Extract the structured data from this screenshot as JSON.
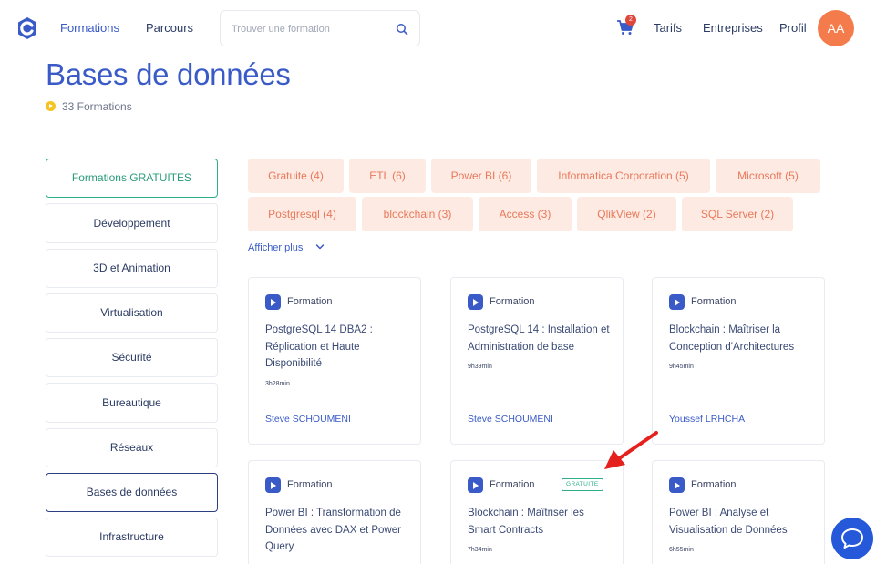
{
  "header": {
    "nav_formations": "Formations",
    "nav_parcours": "Parcours",
    "search_placeholder": "Trouver une formation",
    "cart_count": "2",
    "nav_tarifs": "Tarifs",
    "nav_entreprises": "Entreprises",
    "nav_profil": "Profil",
    "avatar_initials": "AA"
  },
  "page": {
    "title": "Bases de données",
    "count": "33 Formations"
  },
  "sidebar": {
    "items": [
      {
        "label": "Formations GRATUITES",
        "state": "free"
      },
      {
        "label": "Développement"
      },
      {
        "label": "3D et Animation"
      },
      {
        "label": "Virtualisation"
      },
      {
        "label": "Sécurité"
      },
      {
        "label": "Bureautique"
      },
      {
        "label": "Réseaux"
      },
      {
        "label": "Bases de données",
        "state": "active"
      },
      {
        "label": "Infrastructure"
      }
    ]
  },
  "tags": [
    "Gratuite (4)",
    "ETL (6)",
    "Power BI (6)",
    "Informatica Corporation (5)",
    "Microsoft (5)",
    "Postgresql (4)",
    "blockchain (3)",
    "Access (3)",
    "QlikView (2)",
    "SQL Server (2)"
  ],
  "show_more": "Afficher plus",
  "cards": [
    {
      "type": "Formation",
      "title": "PostgreSQL 14 DBA2 : Réplication et Haute Disponibilité",
      "duration": "3h28min",
      "author": "Steve SCHOUMENI"
    },
    {
      "type": "Formation",
      "title": "PostgreSQL 14 : Installation et Administration de base",
      "duration": "9h39min",
      "author": "Steve SCHOUMENI"
    },
    {
      "type": "Formation",
      "title": "Blockchain : Maîtriser la Conception d'Architectures",
      "duration": "9h45min",
      "author": "Youssef LRHCHA"
    },
    {
      "type": "Formation",
      "title": "Power BI : Transformation de Données avec DAX et Power Query",
      "duration": "",
      "author": ""
    },
    {
      "type": "Formation",
      "title": "Blockchain : Maîtriser les Smart Contracts",
      "duration": "7h34min",
      "author": "",
      "badge": "GRATUITE"
    },
    {
      "type": "Formation",
      "title": "Power BI : Analyse et Visualisation de Données",
      "duration": "6h55min",
      "author": ""
    }
  ],
  "colors": {
    "accent": "#3a5bc7",
    "free": "#2dae8c",
    "tag_bg": "#fdeae2",
    "tag_text": "#e9795b",
    "avatar": "#f47c4c",
    "chat": "#2659d9",
    "annotation_arrow": "#e5211e"
  }
}
